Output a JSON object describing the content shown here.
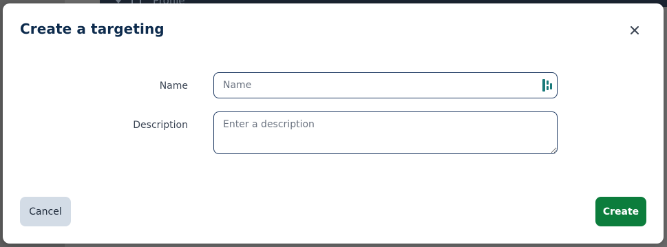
{
  "background": {
    "nav_text": "Profile"
  },
  "modal": {
    "title": "Create a targeting",
    "close_icon": "close-icon",
    "fields": {
      "name": {
        "label": "Name",
        "placeholder": "Name",
        "value": "",
        "icon": "password-manager-icon"
      },
      "description": {
        "label": "Description",
        "placeholder": "Enter a description",
        "value": ""
      }
    },
    "actions": {
      "cancel_label": "Cancel",
      "create_label": "Create"
    }
  },
  "colors": {
    "title": "#0d2b4d",
    "field_border": "#1f3a63",
    "primary_button": "#0c7d3c",
    "secondary_button": "#d3dce6",
    "field_icon": "#1a7a7a"
  }
}
